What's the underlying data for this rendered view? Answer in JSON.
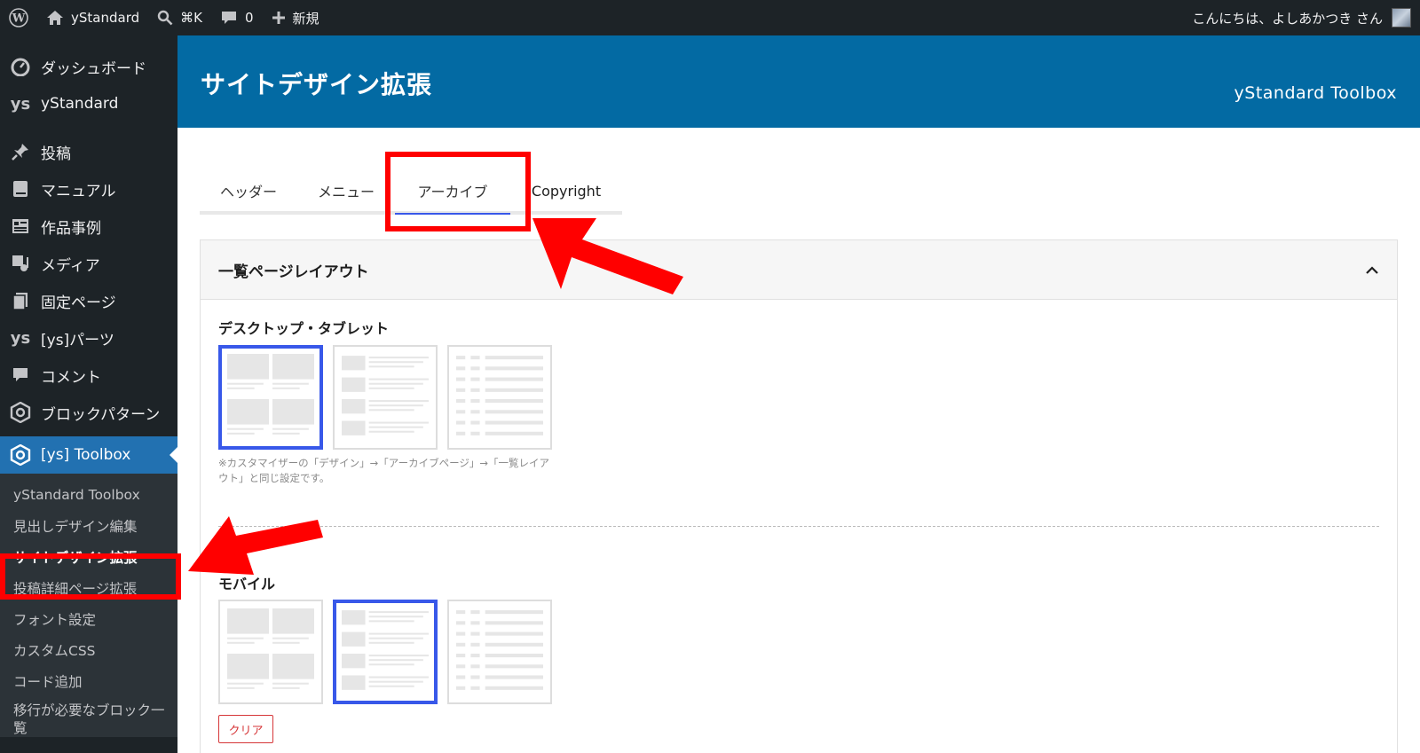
{
  "adminbar": {
    "site_name": "yStandard",
    "search_shortcut": "⌘K",
    "comments_count": "0",
    "new_label": "新規",
    "greeting": "こんにちは、よしあかつき さん"
  },
  "sidebar": {
    "items": [
      {
        "label": "ダッシュボード",
        "icon": "dashboard-icon"
      },
      {
        "label": "yStandard",
        "icon": "ys-logo-icon",
        "icon_text": "ys"
      },
      {
        "label": "投稿",
        "icon": "pin-icon"
      },
      {
        "label": "マニュアル",
        "icon": "book-icon"
      },
      {
        "label": "作品事例",
        "icon": "list-card-icon"
      },
      {
        "label": "メディア",
        "icon": "media-icon"
      },
      {
        "label": "固定ページ",
        "icon": "pages-icon"
      },
      {
        "label": "[ys]パーツ",
        "icon": "ys-logo-icon",
        "icon_text": "ys"
      },
      {
        "label": "コメント",
        "icon": "comment-icon"
      },
      {
        "label": "ブロックパターン",
        "icon": "hexagon-icon"
      }
    ],
    "current": {
      "label": "[ys] Toolbox",
      "icon": "hexagon-icon"
    },
    "submenu": [
      "yStandard Toolbox",
      "見出しデザイン編集",
      "サイトデザイン拡張",
      "投稿詳細ページ拡張",
      "フォント設定",
      "カスタムCSS",
      "コード追加",
      "移行が必要なブロック一覧"
    ]
  },
  "header": {
    "title": "サイトデザイン拡張",
    "brand": "yStandard Toolbox"
  },
  "tabs": [
    "ヘッダー",
    "メニュー",
    "アーカイブ",
    "Copyright"
  ],
  "active_tab": "アーカイブ",
  "panel": {
    "title": "一覧ページレイアウト",
    "desktop_label": "デスクトップ・タブレット",
    "desktop_selected": "card",
    "note": "※カスタマイザーの「デザイン」→「アーカイブページ」→「一覧レイアウト」と同じ設定です。",
    "mobile_label": "モバイル",
    "mobile_selected": "list",
    "clear_label": "クリア"
  },
  "colors": {
    "adminbar_bg": "#1d2327",
    "header_bg": "#036aa3",
    "menu_current": "#2271b1",
    "selection": "#3858e9",
    "annotation": "#ff0000"
  }
}
